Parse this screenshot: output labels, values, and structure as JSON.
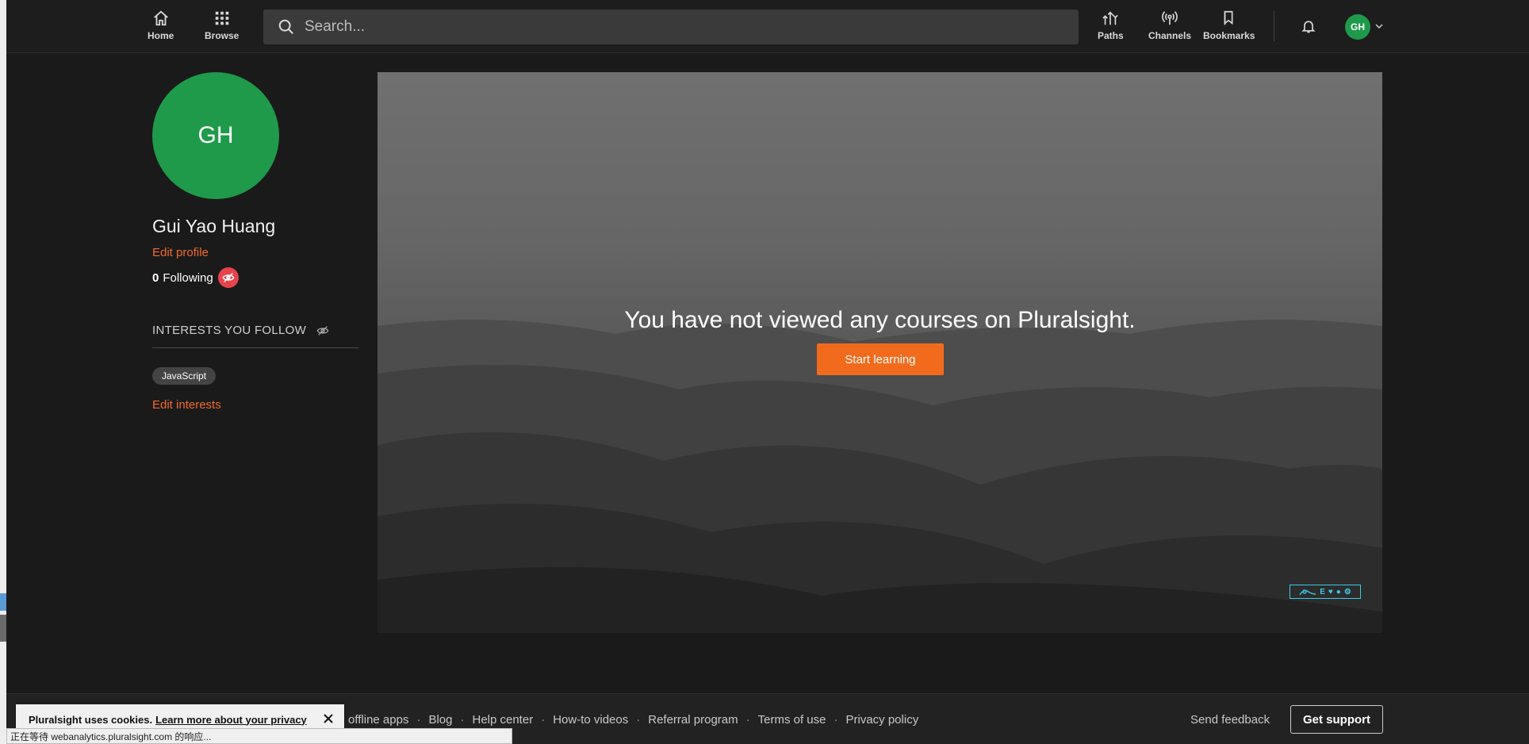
{
  "nav": {
    "home_label": "Home",
    "browse_label": "Browse",
    "search_placeholder": "Search...",
    "paths_label": "Paths",
    "channels_label": "Channels",
    "bookmarks_label": "Bookmarks",
    "user_initials": "GH"
  },
  "profile": {
    "initials": "GH",
    "name": "Gui Yao Huang",
    "edit_profile": "Edit profile",
    "following_count": "0",
    "following_label": "Following",
    "interests_heading": "INTERESTS YOU FOLLOW",
    "interests": [
      "JavaScript"
    ],
    "edit_interests": "Edit interests"
  },
  "hero": {
    "message": "You have not viewed any courses on Pluralsight.",
    "cta": "Start learning",
    "badge_text": "E"
  },
  "footer": {
    "links": [
      "offline apps",
      "Blog",
      "Help center",
      "How-to videos",
      "Referral program",
      "Terms of use",
      "Privacy policy"
    ],
    "send_feedback": "Send feedback",
    "get_support": "Get support"
  },
  "cookie": {
    "text": "Pluralsight uses cookies.",
    "link": "Learn more about your privacy"
  },
  "status_bar": {
    "text": "正在等待 webanalytics.pluralsight.com 的响应..."
  },
  "colors": {
    "accent": "#f26b2a",
    "avatar": "#1f9a4b",
    "cta": "#f26b1d",
    "badge_red": "#e8434c"
  }
}
